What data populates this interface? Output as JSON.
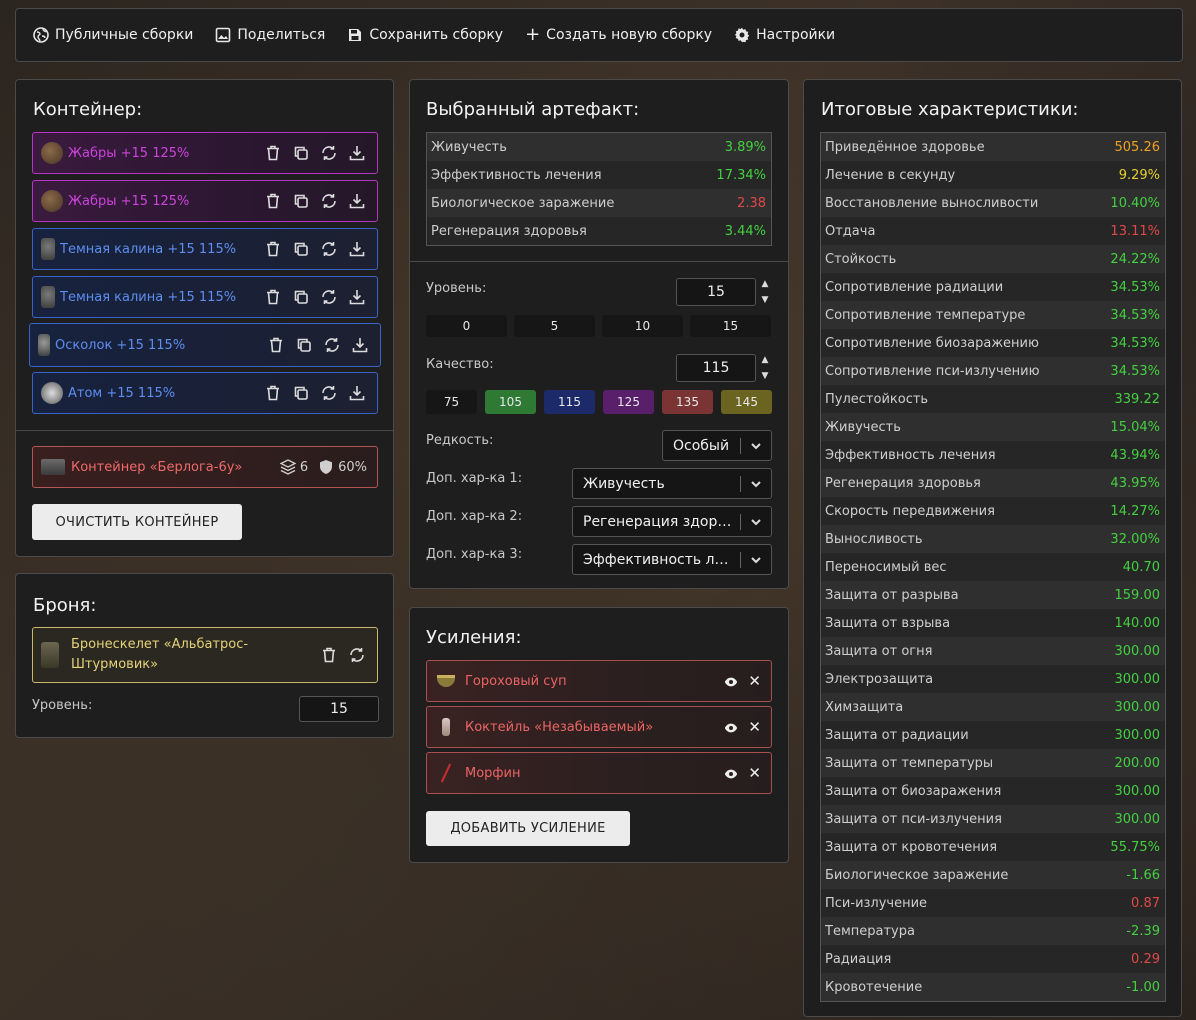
{
  "nav": {
    "public_builds": "Публичные сборки",
    "share": "Поделиться",
    "save_build": "Сохранить сборку",
    "create_build": "Создать новую сборку",
    "settings": "Настройки"
  },
  "container": {
    "title": "Контейнер:",
    "slots": [
      {
        "name": "Жабры +15 125%",
        "color": "purple"
      },
      {
        "name": "Жабры +15 125%",
        "color": "purple"
      },
      {
        "name": "Темная калина +15 115%",
        "color": "blue"
      },
      {
        "name": "Темная калина +15 115%",
        "color": "blue"
      },
      {
        "name": "Осколок +15 115%",
        "color": "blue"
      },
      {
        "name": "Атом +15 115%",
        "color": "blue"
      }
    ],
    "item_name": "Контейнер «Берлога-6у»",
    "capacity": "6",
    "protection": "60%",
    "clear_button": "ОЧИСТИТЬ КОНТЕЙНЕР"
  },
  "armor": {
    "title": "Броня:",
    "item_name_line1": "Бронескелет «Альбатрос-",
    "item_name_line2": "Штурмовик»",
    "level_label": "Уровень:",
    "level_value": "15"
  },
  "artifact": {
    "title": "Выбранный артефакт:",
    "stats": [
      {
        "name": "Живучесть",
        "value": "3.89%",
        "color": "g"
      },
      {
        "name": "Эффективность лечения",
        "value": "17.34%",
        "color": "g"
      },
      {
        "name": "Биологическое заражение",
        "value": "2.38",
        "color": "r"
      },
      {
        "name": "Регенерация здоровья",
        "value": "3.44%",
        "color": "g"
      }
    ],
    "level_label": "Уровень:",
    "level_value": "15",
    "level_presets": [
      "0",
      "5",
      "10",
      "15"
    ],
    "quality_label": "Качество:",
    "quality_value": "115",
    "quality_presets": [
      {
        "label": "75",
        "bg": "#161616"
      },
      {
        "label": "105",
        "bg": "#2e7a34"
      },
      {
        "label": "115",
        "bg": "#1c2a6a"
      },
      {
        "label": "125",
        "bg": "#5a1f6a"
      },
      {
        "label": "135",
        "bg": "#7a3434"
      },
      {
        "label": "145",
        "bg": "#6a6420"
      }
    ],
    "rarity_label": "Редкость:",
    "rarity_value": "Особый",
    "extra1_label": "Доп. хар-ка 1:",
    "extra1_value": "Живучесть",
    "extra2_label": "Доп. хар-ка 2:",
    "extra2_value": "Регенерация здоровья",
    "extra3_label": "Доп. хар-ка 3:",
    "extra3_value": "Эффективность лечения"
  },
  "boosts": {
    "title": "Усиления:",
    "items": [
      {
        "name": "Гороховый суп"
      },
      {
        "name": "Коктейль «Незабываемый»"
      },
      {
        "name": "Морфин"
      }
    ],
    "add_button": "ДОБАВИТЬ УСИЛЕНИЕ"
  },
  "totals": {
    "title": "Итоговые характеристики:",
    "stats": [
      {
        "name": "Приведённое здоровье",
        "value": "505.26",
        "color": "o"
      },
      {
        "name": "Лечение в секунду",
        "value": "9.29%",
        "color": "y"
      },
      {
        "name": "Восстановление выносливости",
        "value": "10.40%",
        "color": "g"
      },
      {
        "name": "Отдача",
        "value": "13.11%",
        "color": "r"
      },
      {
        "name": "Стойкость",
        "value": "24.22%",
        "color": "g"
      },
      {
        "name": "Сопротивление радиации",
        "value": "34.53%",
        "color": "g"
      },
      {
        "name": "Сопротивление температуре",
        "value": "34.53%",
        "color": "g"
      },
      {
        "name": "Сопротивление биозаражению",
        "value": "34.53%",
        "color": "g"
      },
      {
        "name": "Сопротивление пси-излучению",
        "value": "34.53%",
        "color": "g"
      },
      {
        "name": "Пулестойкость",
        "value": "339.22",
        "color": "g"
      },
      {
        "name": "Живучесть",
        "value": "15.04%",
        "color": "g"
      },
      {
        "name": "Эффективность лечения",
        "value": "43.94%",
        "color": "g"
      },
      {
        "name": "Регенерация здоровья",
        "value": "43.95%",
        "color": "g"
      },
      {
        "name": "Скорость передвижения",
        "value": "14.27%",
        "color": "g"
      },
      {
        "name": "Выносливость",
        "value": "32.00%",
        "color": "g"
      },
      {
        "name": "Переносимый вес",
        "value": "40.70",
        "color": "g"
      },
      {
        "name": "Защита от разрыва",
        "value": "159.00",
        "color": "g"
      },
      {
        "name": "Защита от взрыва",
        "value": "140.00",
        "color": "g"
      },
      {
        "name": "Защита от огня",
        "value": "300.00",
        "color": "g"
      },
      {
        "name": "Электрозащита",
        "value": "300.00",
        "color": "g"
      },
      {
        "name": "Химзащита",
        "value": "300.00",
        "color": "g"
      },
      {
        "name": "Защита от радиации",
        "value": "300.00",
        "color": "g"
      },
      {
        "name": "Защита от температуры",
        "value": "200.00",
        "color": "g"
      },
      {
        "name": "Защита от биозаражения",
        "value": "300.00",
        "color": "g"
      },
      {
        "name": "Защита от пси-излучения",
        "value": "300.00",
        "color": "g"
      },
      {
        "name": "Защита от кровотечения",
        "value": "55.75%",
        "color": "g"
      },
      {
        "name": "Биологическое заражение",
        "value": "-1.66",
        "color": "g"
      },
      {
        "name": "Пси-излучение",
        "value": "0.87",
        "color": "r"
      },
      {
        "name": "Температура",
        "value": "-2.39",
        "color": "g"
      },
      {
        "name": "Радиация",
        "value": "0.29",
        "color": "r"
      },
      {
        "name": "Кровотечение",
        "value": "-1.00",
        "color": "g"
      }
    ]
  }
}
